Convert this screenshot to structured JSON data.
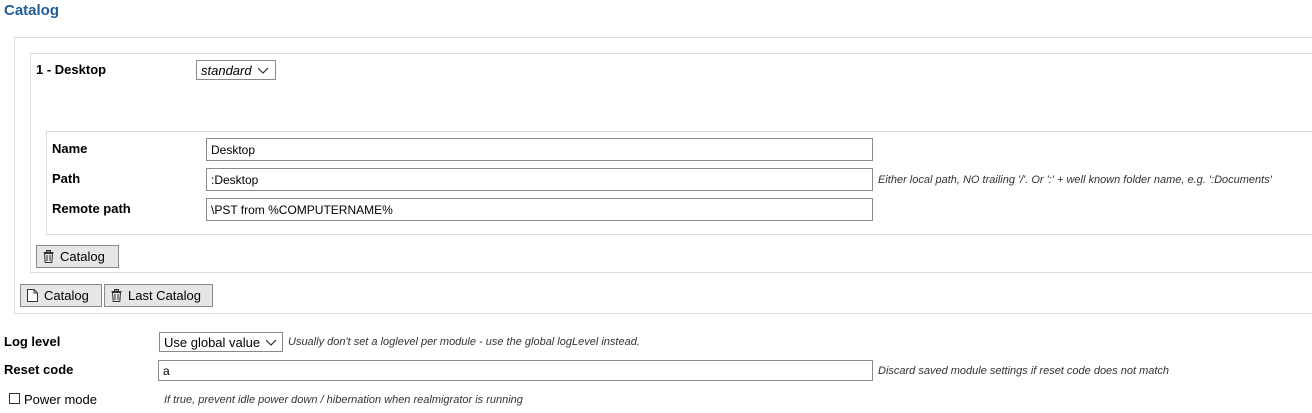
{
  "page": {
    "title": "Catalog"
  },
  "catalog_item": {
    "heading": "1 - Desktop",
    "mode_select": "standard",
    "fields": {
      "name": {
        "label": "Name",
        "value": "Desktop"
      },
      "path": {
        "label": "Path",
        "value": ":Desktop",
        "hint": "Either local path, NO trailing '/'. Or ':' + well known folder name, e.g. ':Documents'"
      },
      "remote_path": {
        "label": "Remote path",
        "value": "\\PST from %COMPUTERNAME%"
      }
    },
    "delete_button": "Catalog"
  },
  "catalog_actions": {
    "add_button": "Catalog",
    "delete_last_button": "Last Catalog"
  },
  "settings": {
    "log_level": {
      "label": "Log level",
      "value": "Use global value",
      "hint": "Usually don't set a loglevel per module - use the global logLevel instead."
    },
    "reset_code": {
      "label": "Reset code",
      "value": "a",
      "hint": "Discard saved module settings if reset code does not match"
    },
    "power_mode": {
      "label": "Power mode",
      "checked": false,
      "hint": "If true, prevent idle power down / hibernation when realmigrator is running"
    }
  },
  "icons": {
    "delete": "trash-icon",
    "add": "new-document-icon",
    "dropdown": "chevron-down-icon"
  }
}
